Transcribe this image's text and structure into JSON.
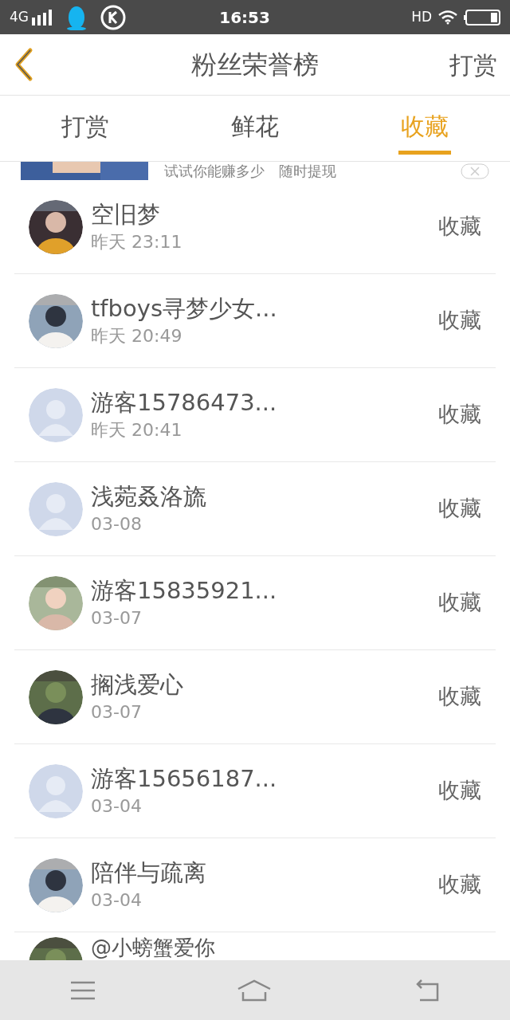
{
  "status_bar": {
    "network": "4G",
    "time": "16:53",
    "hd": "HD"
  },
  "header": {
    "title": "粉丝荣誉榜",
    "action": "打赏"
  },
  "tabs": [
    {
      "label": "打赏",
      "selected": false
    },
    {
      "label": "鲜花",
      "selected": false
    },
    {
      "label": "收藏",
      "selected": true
    }
  ],
  "banner": {
    "text": "试试你能赚多少　随时提现"
  },
  "fans": [
    {
      "name": "空旧梦",
      "time": "昨天 23:11",
      "action": "收藏"
    },
    {
      "name": "tfboys寻梦少女...",
      "time": "昨天 20:49",
      "action": "收藏"
    },
    {
      "name": "游客15786473...",
      "time": "昨天 20:41",
      "action": "收藏",
      "avatar": {
        "kind": "default"
      }
    },
    {
      "name": "浅菀叒洛旒",
      "time": "03-08",
      "action": "收藏",
      "avatar": {
        "kind": "default"
      }
    },
    {
      "name": "游客15835921...",
      "time": "03-07",
      "action": "收藏"
    },
    {
      "name": "搁浅爱心",
      "time": "03-07",
      "action": "收藏"
    },
    {
      "name": "游客15656187...",
      "time": "03-04",
      "action": "收藏",
      "avatar": {
        "kind": "default"
      }
    },
    {
      "name": "陪伴与疏离",
      "time": "03-04",
      "action": "收藏"
    }
  ],
  "partial_fan": {
    "name": "@小螃蟹爱你"
  }
}
